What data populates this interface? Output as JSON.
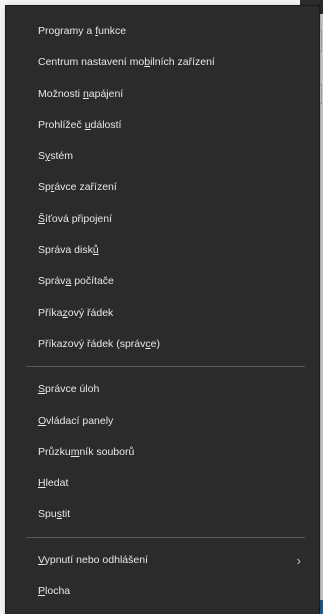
{
  "menu": {
    "group1": [
      {
        "pre": "Programy a ",
        "acc": "f",
        "post": "unkce"
      },
      {
        "pre": "Centrum nastavení mo",
        "acc": "b",
        "post": "ilních zařízení"
      },
      {
        "pre": "Možnosti ",
        "acc": "n",
        "post": "apájení"
      },
      {
        "pre": "Prohlížeč ",
        "acc": "u",
        "post": "dálostí"
      },
      {
        "pre": "S",
        "acc": "y",
        "post": "stém"
      },
      {
        "pre": "Sp",
        "acc": "r",
        "post": "ávce zařízení"
      },
      {
        "pre": "",
        "acc": "Š",
        "post": "íťová připojení"
      },
      {
        "pre": "Správa disk",
        "acc": "ů",
        "post": ""
      },
      {
        "pre": "Správ",
        "acc": "a",
        "post": " počítače"
      },
      {
        "pre": "Příka",
        "acc": "z",
        "post": "ový řádek"
      },
      {
        "pre": "Příkazový řádek (správ",
        "acc": "c",
        "post": "e)"
      }
    ],
    "group2": [
      {
        "pre": "",
        "acc": "S",
        "post": "právce úloh"
      },
      {
        "pre": "",
        "acc": "O",
        "post": "vládací panely"
      },
      {
        "pre": "Průzku",
        "acc": "m",
        "post": "ník souborů"
      },
      {
        "pre": "",
        "acc": "H",
        "post": "ledat"
      },
      {
        "pre": "Spu",
        "acc": "s",
        "post": "tit"
      }
    ],
    "group3": [
      {
        "pre": "",
        "acc": "V",
        "post": "ypnutí nebo odhlášení",
        "submenu": true
      },
      {
        "pre": "",
        "acc": "P",
        "post": "locha"
      }
    ]
  }
}
